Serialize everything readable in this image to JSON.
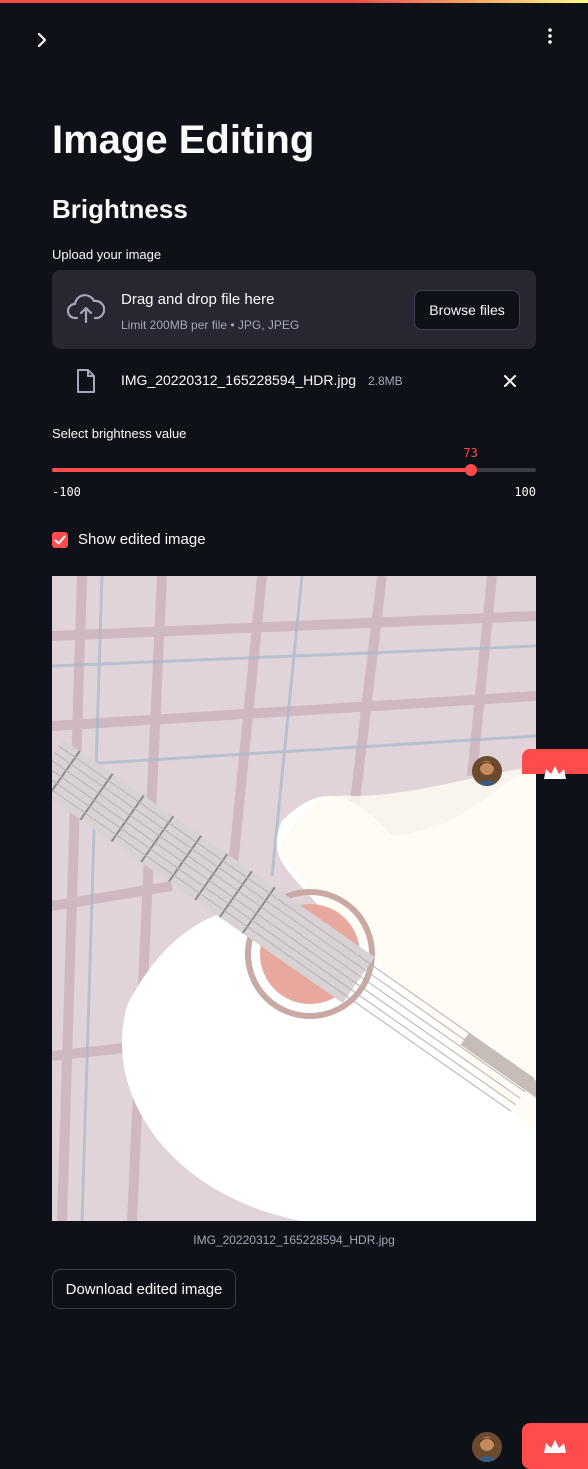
{
  "header": {
    "sidebar_toggle_icon": "chevron-right-icon",
    "menu_icon": "kebab-menu-icon"
  },
  "page": {
    "title": "Image Editing",
    "subtitle": "Brightness"
  },
  "uploader": {
    "label": "Upload your image",
    "drop_title": "Drag and drop file here",
    "drop_limit": "Limit 200MB per file • JPG, JPEG",
    "browse_label": "Browse files",
    "icon": "cloud-upload-icon"
  },
  "uploaded_file": {
    "name": "IMG_20220312_165228594_HDR.jpg",
    "size": "2.8MB",
    "icon": "file-icon",
    "remove_icon": "close-icon"
  },
  "slider": {
    "label": "Select brightness value",
    "min": -100,
    "max": 100,
    "value": 73,
    "min_label": "-100",
    "max_label": "100",
    "value_label": "73"
  },
  "checkbox": {
    "label": "Show edited image",
    "checked": true
  },
  "image": {
    "caption": "IMG_20220312_165228594_HDR.jpg"
  },
  "download": {
    "label": "Download edited image"
  },
  "colors": {
    "accent": "#ff4b4b",
    "background": "#0e1117",
    "surface": "#262730"
  }
}
